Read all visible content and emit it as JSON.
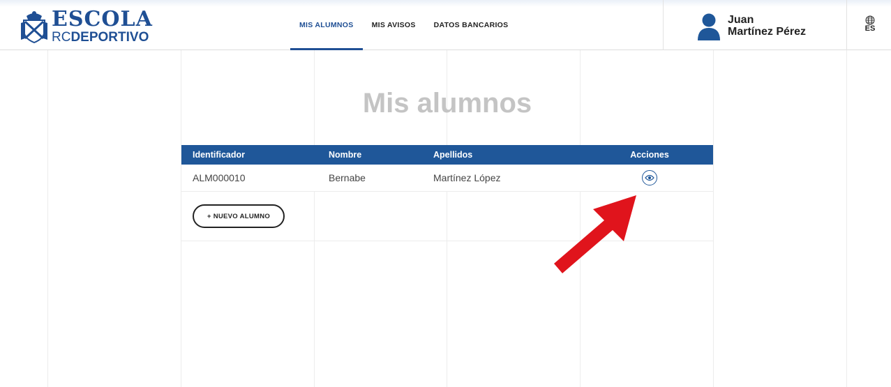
{
  "brand": {
    "line1": "ESCOLA",
    "line2_prefix": "RC",
    "line2_bold": "DEPORTIVO",
    "color": "#1f4f94"
  },
  "nav": {
    "items": [
      {
        "label": "MIS ALUMNOS",
        "active": true
      },
      {
        "label": "MIS AVISOS",
        "active": false
      },
      {
        "label": "DATOS BANCARIOS",
        "active": false
      }
    ]
  },
  "user": {
    "first_name": "Juan",
    "last_name": "Martínez Pérez",
    "icon": "user-avatar-icon"
  },
  "language": {
    "code": "ES",
    "icon": "globe-icon"
  },
  "page": {
    "title": "Mis alumnos"
  },
  "table": {
    "columns": [
      "Identificador",
      "Nombre",
      "Apellidos",
      "Acciones"
    ],
    "rows": [
      {
        "id": "ALM000010",
        "name": "Bernabe",
        "surname": "Martínez López",
        "action_icon": "eye-icon"
      }
    ],
    "header_color": "#1f5799"
  },
  "actions": {
    "new_student": "+ NUEVO ALUMNO"
  },
  "annotation": {
    "arrow_color": "#e0141c",
    "icon": "red-arrow-icon"
  }
}
